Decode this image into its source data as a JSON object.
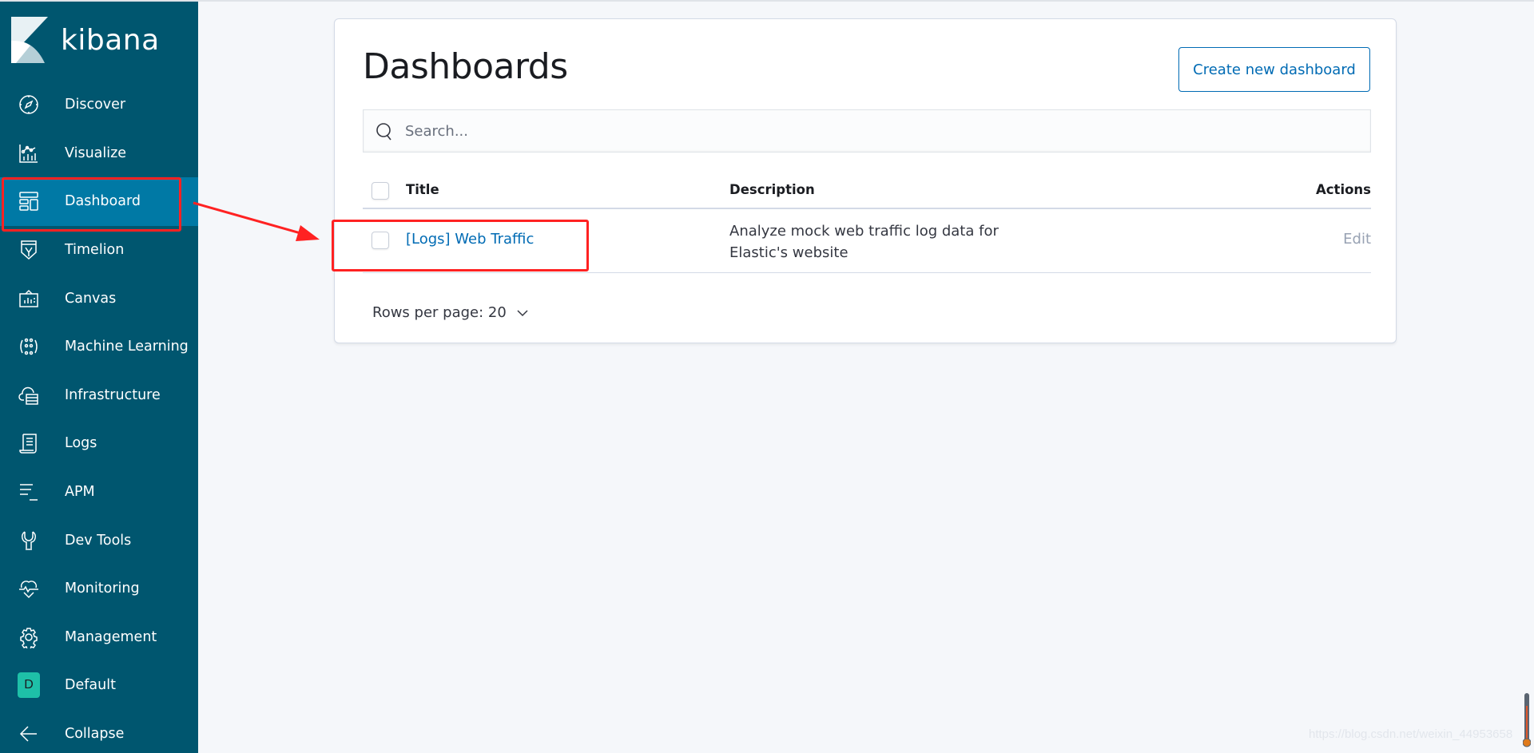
{
  "app": {
    "name": "kibana"
  },
  "sidebar": {
    "items": [
      {
        "label": "Discover",
        "icon": "compass-icon"
      },
      {
        "label": "Visualize",
        "icon": "visualize-icon"
      },
      {
        "label": "Dashboard",
        "icon": "dashboard-icon",
        "active": true
      },
      {
        "label": "Timelion",
        "icon": "timelion-icon"
      },
      {
        "label": "Canvas",
        "icon": "canvas-icon"
      },
      {
        "label": "Machine Learning",
        "icon": "machine-learning-icon"
      },
      {
        "label": "Infrastructure",
        "icon": "infrastructure-icon"
      },
      {
        "label": "Logs",
        "icon": "logs-icon"
      },
      {
        "label": "APM",
        "icon": "apm-icon"
      },
      {
        "label": "Dev Tools",
        "icon": "wrench-icon"
      },
      {
        "label": "Monitoring",
        "icon": "heartbeat-icon"
      },
      {
        "label": "Management",
        "icon": "gear-icon"
      },
      {
        "label": "Default",
        "icon": "space-avatar",
        "badge": "D"
      },
      {
        "label": "Collapse",
        "icon": "arrow-left-icon"
      }
    ]
  },
  "main": {
    "title": "Dashboards",
    "create_button": "Create new dashboard",
    "search": {
      "placeholder": "Search...",
      "value": ""
    },
    "table": {
      "columns": [
        "Title",
        "Description",
        "Actions"
      ],
      "rows": [
        {
          "title": "[Logs] Web Traffic",
          "description": "Analyze mock web traffic log data for Elastic's website",
          "action": "Edit"
        }
      ]
    },
    "pagination": {
      "rows_per_page_label": "Rows per page: 20"
    }
  },
  "colors": {
    "sidebar_bg": "#00566f",
    "sidebar_active": "#0079a5",
    "link": "#006bb4",
    "annotation": "#ff2222",
    "space_badge": "#1ec0a8"
  },
  "watermark": "https://blog.csdn.net/weixin_44953658"
}
